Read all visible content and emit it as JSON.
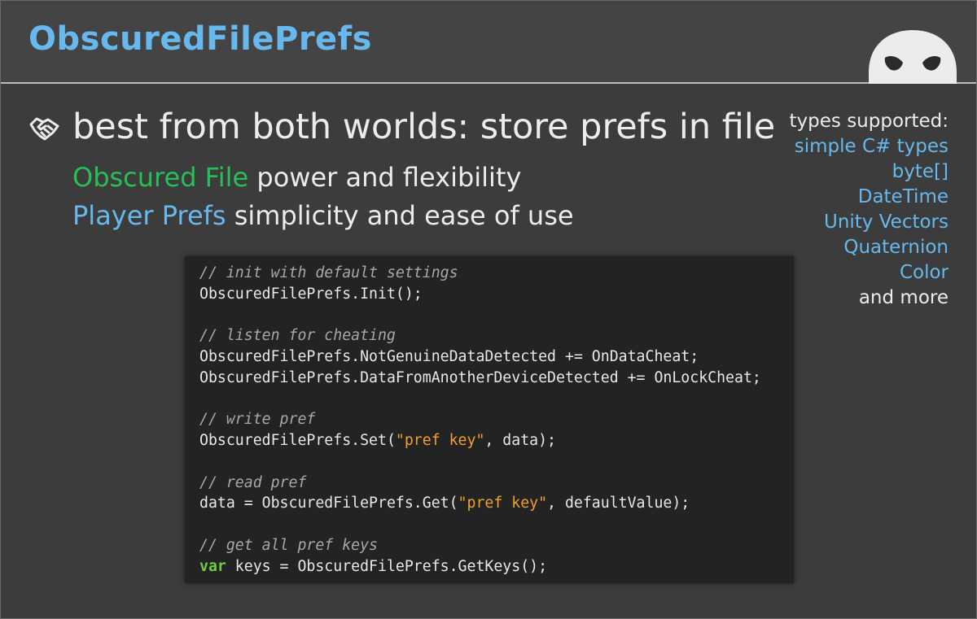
{
  "title": "ObscuredFilePrefs",
  "headline": "best from both worlds: store prefs in file",
  "sub1": {
    "highlight": "Obscured File",
    "rest": " power and flexibility"
  },
  "sub2": {
    "highlight": "Player Prefs",
    "rest": " simplicity and ease of use"
  },
  "types": {
    "heading": "types supported:",
    "items": [
      "simple C# types",
      "byte[]",
      "DateTime",
      "Unity Vectors",
      "Quaternion",
      "Color"
    ],
    "more": "and more"
  },
  "code": {
    "c1": "// init with default settings",
    "l1": "ObscuredFilePrefs.Init();",
    "c2": "// listen for cheating",
    "l2": "ObscuredFilePrefs.NotGenuineDataDetected += OnDataCheat;",
    "l3": "ObscuredFilePrefs.DataFromAnotherDeviceDetected += OnLockCheat;",
    "c3": "// write pref",
    "l4a": "ObscuredFilePrefs.Set(",
    "l4s": "\"pref key\"",
    "l4b": ", data);",
    "c4": "// read pref",
    "l5a": "data = ObscuredFilePrefs.Get(",
    "l5s": "\"pref key\"",
    "l5b": ", defaultValue);",
    "c5": "// get all pref keys",
    "l6k": "var",
    "l6b": " keys = ObscuredFilePrefs.GetKeys();"
  },
  "colors": {
    "accent_blue": "#67b8ec",
    "accent_green": "#25c058",
    "string_orange": "#f0a030",
    "keyword_green": "#6fcf3a",
    "background": "#3c3c3c",
    "code_background": "#232323"
  },
  "icons": {
    "bullet": "handshake-icon",
    "logo": "mascot-icon"
  }
}
